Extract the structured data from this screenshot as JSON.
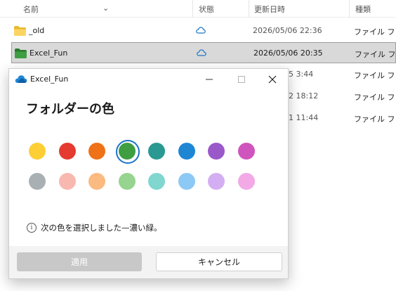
{
  "explorer": {
    "columns": {
      "name": "名前",
      "status": "状態",
      "modified": "更新日時",
      "type": "種類"
    },
    "rows": [
      {
        "name": "_old",
        "date": "2026/05/06 22:36",
        "type": "ファイル フォル",
        "folder_color": "#f4c542"
      },
      {
        "name": "Excel_Fun",
        "date": "2026/05/06 20:35",
        "type": "ファイル フォル",
        "folder_color": "#3a9a3e"
      }
    ],
    "hidden_rows": [
      {
        "date_partial": "5 3:44",
        "type": "ファイル フォル"
      },
      {
        "date_partial": "2 18:12",
        "type": "ファイル フォル"
      },
      {
        "date_partial": "1 11:44",
        "type": "ファイル フォル"
      }
    ]
  },
  "dialog": {
    "title": "Excel_Fun",
    "heading": "フォルダーの色",
    "swatches_row1": [
      {
        "name": "yellow",
        "color": "#fdcf35"
      },
      {
        "name": "red",
        "color": "#e53a30"
      },
      {
        "name": "orange",
        "color": "#ef7118"
      },
      {
        "name": "green",
        "color": "#3e9e41",
        "selected": true
      },
      {
        "name": "teal",
        "color": "#2a9992"
      },
      {
        "name": "blue",
        "color": "#1f86d4"
      },
      {
        "name": "purple",
        "color": "#9a58c9"
      },
      {
        "name": "magenta",
        "color": "#d054bd"
      }
    ],
    "swatches_row2": [
      {
        "name": "gray",
        "color": "#a9b0b4"
      },
      {
        "name": "light-red",
        "color": "#f8b8b0"
      },
      {
        "name": "light-orange",
        "color": "#fbba80"
      },
      {
        "name": "light-green",
        "color": "#97d48f"
      },
      {
        "name": "light-teal",
        "color": "#7fd7d0"
      },
      {
        "name": "light-blue",
        "color": "#8cc9f5"
      },
      {
        "name": "light-purple",
        "color": "#d4aef2"
      },
      {
        "name": "light-magenta",
        "color": "#f2a9e6"
      }
    ],
    "info_text": "次の色を選択しました—濃い緑。",
    "apply_label": "適用",
    "cancel_label": "キャンセル",
    "accent": "#1a73c9"
  }
}
